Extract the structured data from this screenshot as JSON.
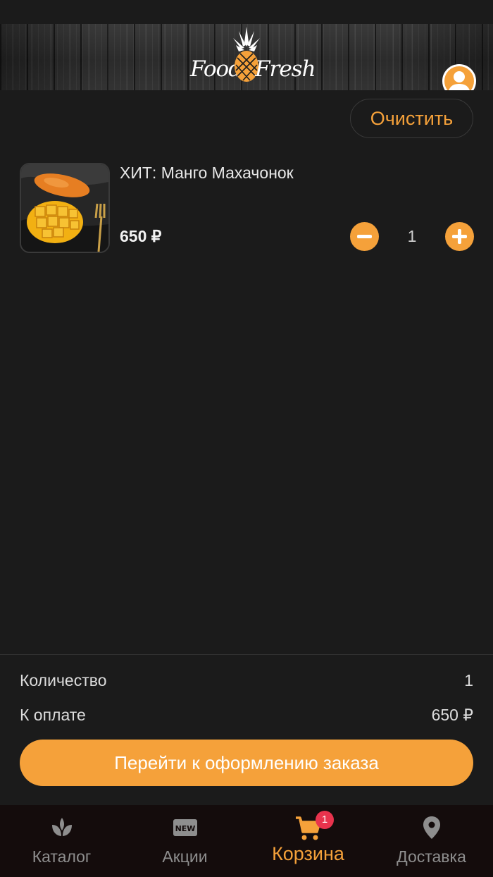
{
  "header": {
    "logo_left": "Food",
    "logo_right": "Fresh"
  },
  "cart": {
    "clear_label": "Очистить",
    "items": [
      {
        "name": "ХИТ: Манго Махачонок",
        "price": "650 ₽",
        "quantity": "1"
      }
    ]
  },
  "summary": {
    "quantity_label": "Количество",
    "quantity_value": "1",
    "pay_label": "К оплате",
    "pay_value": "650 ₽",
    "checkout_label": "Перейти к оформлению заказа"
  },
  "tabbar": {
    "tabs": [
      {
        "label": "Каталог",
        "icon": "plant-icon"
      },
      {
        "label": "Акции",
        "icon": "new-badge-icon"
      },
      {
        "label": "Корзина",
        "icon": "cart-icon"
      },
      {
        "label": "Доставка",
        "icon": "location-pin-icon"
      }
    ],
    "active_tab": "Корзина",
    "cart_badge": "1"
  },
  "colors": {
    "accent": "#f5a13a",
    "background": "#1b1b1b",
    "tabbar_background": "#140c0c",
    "badge": "#e8334d"
  }
}
